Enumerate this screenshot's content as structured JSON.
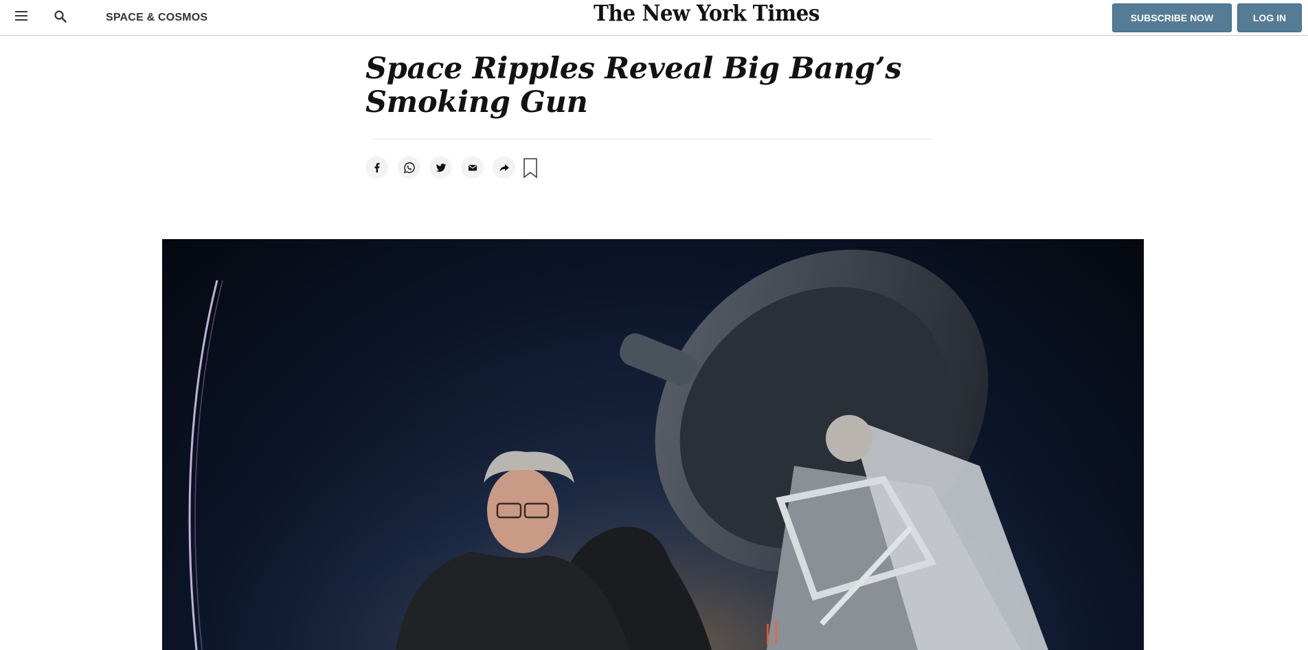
{
  "header": {
    "section": "SPACE & COSMOS",
    "logo": "The New York Times",
    "subscribe_label": "SUBSCRIBE NOW",
    "login_label": "LOG IN",
    "accent_color": "#567b95"
  },
  "article": {
    "headline": "Space Ripples Reveal Big Bang’s Smoking Gun"
  },
  "share": {
    "icons": [
      "facebook-icon",
      "whatsapp-icon",
      "twitter-icon",
      "email-icon",
      "share-icon",
      "bookmark-icon"
    ]
  }
}
